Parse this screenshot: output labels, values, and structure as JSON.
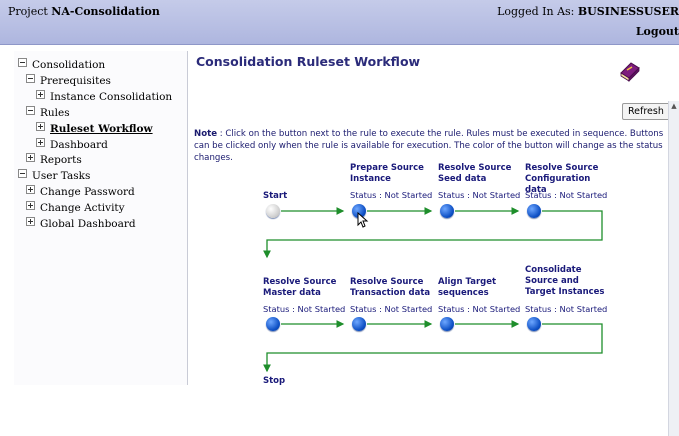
{
  "header": {
    "project_prefix": "Project",
    "project_name": "NA-Consolidation",
    "logged_in_prefix": "Logged In As:",
    "user_name": "BUSINESSUSER",
    "logout_label": "Logout"
  },
  "sidebar": {
    "consolidation": "Consolidation",
    "prerequisites": "Prerequisites",
    "instance_consolidation": "Instance Consolidation",
    "rules": "Rules",
    "ruleset_workflow": "Ruleset Workflow",
    "dashboard": "Dashboard",
    "reports": "Reports",
    "user_tasks": "User Tasks",
    "change_password": "Change Password",
    "change_activity": "Change Activity",
    "global_dashboard": "Global Dashboard"
  },
  "main": {
    "title": "Consolidation Ruleset Workflow",
    "refresh_label": "Refresh",
    "note_label": "Note",
    "note_text": ": Click on the button next to the rule to execute the rule. Rules must be executed in sequence. Buttons can be clicked only when the rule is available for execution. The color of the button will change as the status changes."
  },
  "workflow": {
    "status_prefix": "Status :",
    "start_label": "Start",
    "stop_label": "Stop",
    "steps": [
      {
        "title": "Prepare Source Instance",
        "status": "Not Started"
      },
      {
        "title": "Resolve Source Seed data",
        "status": "Not Started"
      },
      {
        "title": "Resolve Source Configuration data",
        "status": "Not Started"
      },
      {
        "title": "Resolve Source Master data",
        "status": "Not Started"
      },
      {
        "title": "Resolve Source Transaction data",
        "status": "Not Started"
      },
      {
        "title": "Align Target sequences",
        "status": "Not Started"
      },
      {
        "title": "Consolidate Source and Target Instances",
        "status": "Not Started"
      }
    ]
  },
  "colors": {
    "header_bg": "#b7bfe5",
    "connector": "#1e8e2b",
    "button_active": "#1257cf",
    "button_start": "#d0d0d0",
    "text_blue": "#1a1a7a"
  }
}
